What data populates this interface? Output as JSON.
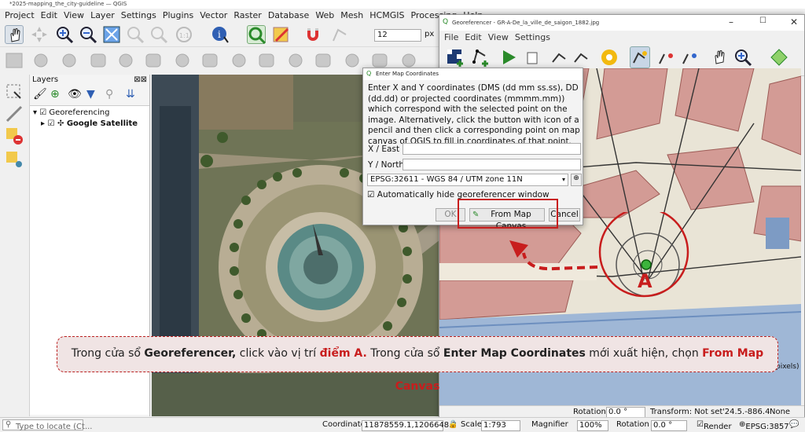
{
  "window": {
    "title": "*2025-mapping_the_city-guideline — QGIS"
  },
  "menu": [
    "Project",
    "Edit",
    "View",
    "Layer",
    "Settings",
    "Plugins",
    "Vector",
    "Raster",
    "Database",
    "Web",
    "Mesh",
    "HCMGIS",
    "Processing",
    "Help"
  ],
  "toolbar": {
    "font_size": "12",
    "font_unit": "px"
  },
  "layers": {
    "title": "Layers",
    "items": [
      {
        "label": "Georeferencing"
      },
      {
        "label": "Google Satellite"
      }
    ]
  },
  "georeferencer": {
    "title": "Georeferencer - GR-A-De_la_ville_de_saigon_1882.jpg",
    "menu": [
      "File",
      "Edit",
      "View",
      "Settings"
    ],
    "status": {
      "rotation_label": "Rotation",
      "rotation_value": "0.0 °",
      "transform": "Transform: Not set",
      "coords": "'24.5.-886.4",
      "none": "None",
      "pixels": "pixels)"
    }
  },
  "dialog": {
    "title": "Enter Map Coordinates",
    "instructions": "Enter X and Y coordinates (DMS (dd mm ss.ss), DD (dd.dd) or projected coordinates (mmmm.mm)) which correspond with the selected point on the image. Alternatively, click the button with icon of a pencil and then click a corresponding point on map canvas of QGIS to fill in coordinates of that point.",
    "x_label": "X / East",
    "x_value": "",
    "y_label": "Y / North",
    "y_value": "",
    "crs": "EPSG:32611 - WGS 84 / UTM zone 11N",
    "auto_hide": "Automatically hide georeferencer window",
    "ok": "OK",
    "from_canvas": "From Map Canvas",
    "cancel": "Cancel"
  },
  "annotation": {
    "point_label": "A"
  },
  "caption": {
    "p1": "Trong cửa sổ ",
    "b1": "Georeferencer,",
    "p2": " click vào vị trí ",
    "r1": "điểm A.",
    "p3": " Trong cửa sổ ",
    "b2": "Enter Map Coordinates",
    "p4": " mới xuất hiện, chọn ",
    "r2": "From Map Canvas"
  },
  "status": {
    "locate_placeholder": "Type to locate (Ct...",
    "coordinate_label": "Coordinate",
    "coordinate_value": "11878559.1,1206648.3",
    "scale_label": "Scale",
    "scale_value": "1:793",
    "magnifier_label": "Magnifier",
    "magnifier_value": "100%",
    "rotation_label": "Rotation",
    "rotation_value": "0.0 °",
    "render_label": "Render",
    "crs_label": "EPSG:3857"
  },
  "colors": {
    "accent_red": "#c81d1d",
    "dialog_bg": "#f3f3f3"
  }
}
